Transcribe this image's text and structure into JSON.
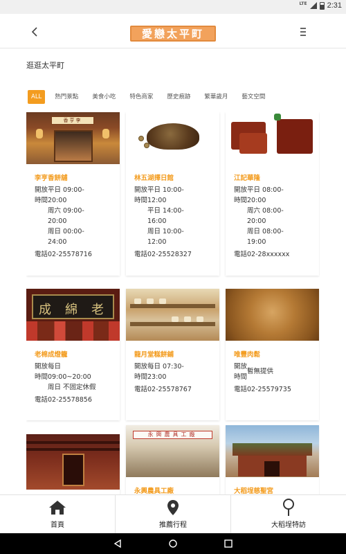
{
  "status_bar": {
    "network": "LTE",
    "time": "2:31"
  },
  "header": {
    "logo_text": "愛戀太平町"
  },
  "page": {
    "title": "逛逛太平町"
  },
  "tabs": [
    {
      "label": "ALL",
      "active": true
    },
    {
      "label": "熱門景點"
    },
    {
      "label": "美食小吃"
    },
    {
      "label": "特色商家"
    },
    {
      "label": "歷史痕跡"
    },
    {
      "label": "繁華歲月"
    },
    {
      "label": "藝文空間"
    }
  ],
  "cards": [
    {
      "title": "李亨香餅舖",
      "image_sign": "香亨李",
      "hours_label": "開放\n時間",
      "hours": "平日 09:00-\n20:00\n周六 09:00-\n20:00\n周日 00:00-\n24:00",
      "phone_label": "電話",
      "phone": "02-25578716"
    },
    {
      "title": "林五湖擇日館",
      "hours_label": "開放\n時間",
      "hours": "平日 10:00-\n12:00\n平日 14:00-\n16:00\n周日 10:00-\n12:00",
      "phone_label": "電話",
      "phone": "02-25528327"
    },
    {
      "title": "江記華隆",
      "hours_label": "開放\n時間",
      "hours": "平日 08:00-\n20:00\n周六 08:00-\n20:00\n周日 08:00-\n19:00",
      "phone_label": "電話",
      "phone": "02-28xxxxxx"
    },
    {
      "title": "老棉成燈籠",
      "image_sign": "老綿成",
      "hours_label": "開放\n時間",
      "hours": "每日\n09:00~20:00\n周日 不固定休假",
      "phone_label": "電話",
      "phone": "02-25578856"
    },
    {
      "title": "龍月堂糕餅鋪",
      "hours_label": "開放\n時間",
      "hours": "每日 07:30-\n23:00",
      "phone_label": "電話",
      "phone": "02-25578767"
    },
    {
      "title": "唯豐肉鬆",
      "hours_label": "開放\n時間",
      "hours": "暫無提供",
      "phone_label": "電話",
      "phone": "02-25579735"
    },
    {
      "title": ""
    },
    {
      "title": "永興農具工廠",
      "image_sign": "永興農具工廠"
    },
    {
      "title": "大稻埕慈聖宮"
    }
  ],
  "bottom_nav": [
    {
      "label": "首頁",
      "icon": "home-icon"
    },
    {
      "label": "推薦行程",
      "icon": "map-pin-icon"
    },
    {
      "label": "大稻埕特訪",
      "icon": "location-search-icon"
    }
  ],
  "colors": {
    "accent": "#f39c1f",
    "logo_bg": "#f2a25c"
  }
}
